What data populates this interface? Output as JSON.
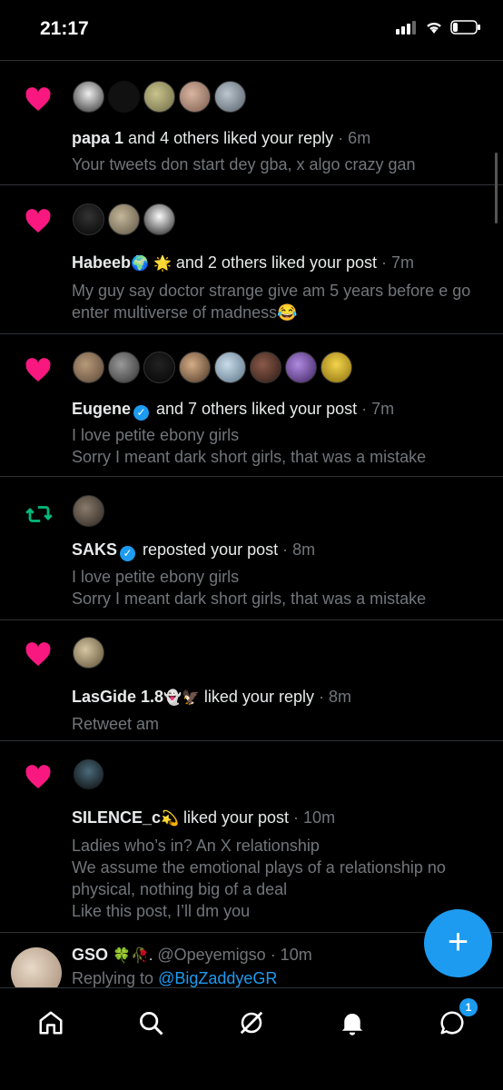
{
  "status_bar": {
    "time": "21:17"
  },
  "notifications": [
    {
      "type": "like",
      "actor": "papa 1",
      "action": " and 4 others liked your reply",
      "time": "· 6m",
      "body": [
        "Your tweets don start dey gba, x algo crazy gan"
      ]
    },
    {
      "type": "like",
      "actor": "Habeeb",
      "actor_emoji": "🌍",
      "extra_emoji": "🌟",
      "action": " and 2 others liked your post",
      "time": "· 7m",
      "body": [
        "My guy say doctor strange give am 5 years before e go enter multiverse of madness😂"
      ]
    },
    {
      "type": "like",
      "actor": "Eugene",
      "verified": true,
      "action": " and 7 others liked your post",
      "time": "· 7m",
      "body": [
        "I love petite ebony girls",
        "Sorry I meant dark short girls, that was a mistake"
      ]
    },
    {
      "type": "repost",
      "actor": "SAKS",
      "verified": true,
      "action": " reposted your post",
      "time": "· 8m",
      "body": [
        "I love petite ebony girls",
        "Sorry I meant dark short girls, that was a mistake"
      ]
    },
    {
      "type": "like",
      "actor": "LasGide 1.8",
      "actor_emoji": "👻🦅",
      "action": " liked your reply",
      "time": "· 8m",
      "body": [
        "Retweet am"
      ]
    },
    {
      "type": "like",
      "actor": "SILENCE_c",
      "actor_emoji": "💫",
      "action": " liked your post",
      "time": "· 10m",
      "body": [
        "Ladies who’s in? An X relationship",
        "We assume the emotional plays of a relationship no physical, nothing big of a deal",
        "Like this post, I’ll dm you"
      ]
    }
  ],
  "reply_preview": {
    "name": "GSO",
    "name_emoji": "🍀🥀.",
    "handle": "@Opeyemigso",
    "time": "· 10m",
    "replying_to_label": "Replying to",
    "replying_to_handle": "@BigZaddyeGR"
  },
  "fab": {
    "label": "+"
  },
  "tabbar": {
    "tabs": [
      "home-icon",
      "search-icon",
      "grok-icon",
      "notifications-icon",
      "messages-icon"
    ],
    "messages_badge": "1"
  },
  "colors": {
    "like": "#f91880",
    "repost": "#00ba7c",
    "accent": "#1d9bf0",
    "muted": "#71767b"
  }
}
